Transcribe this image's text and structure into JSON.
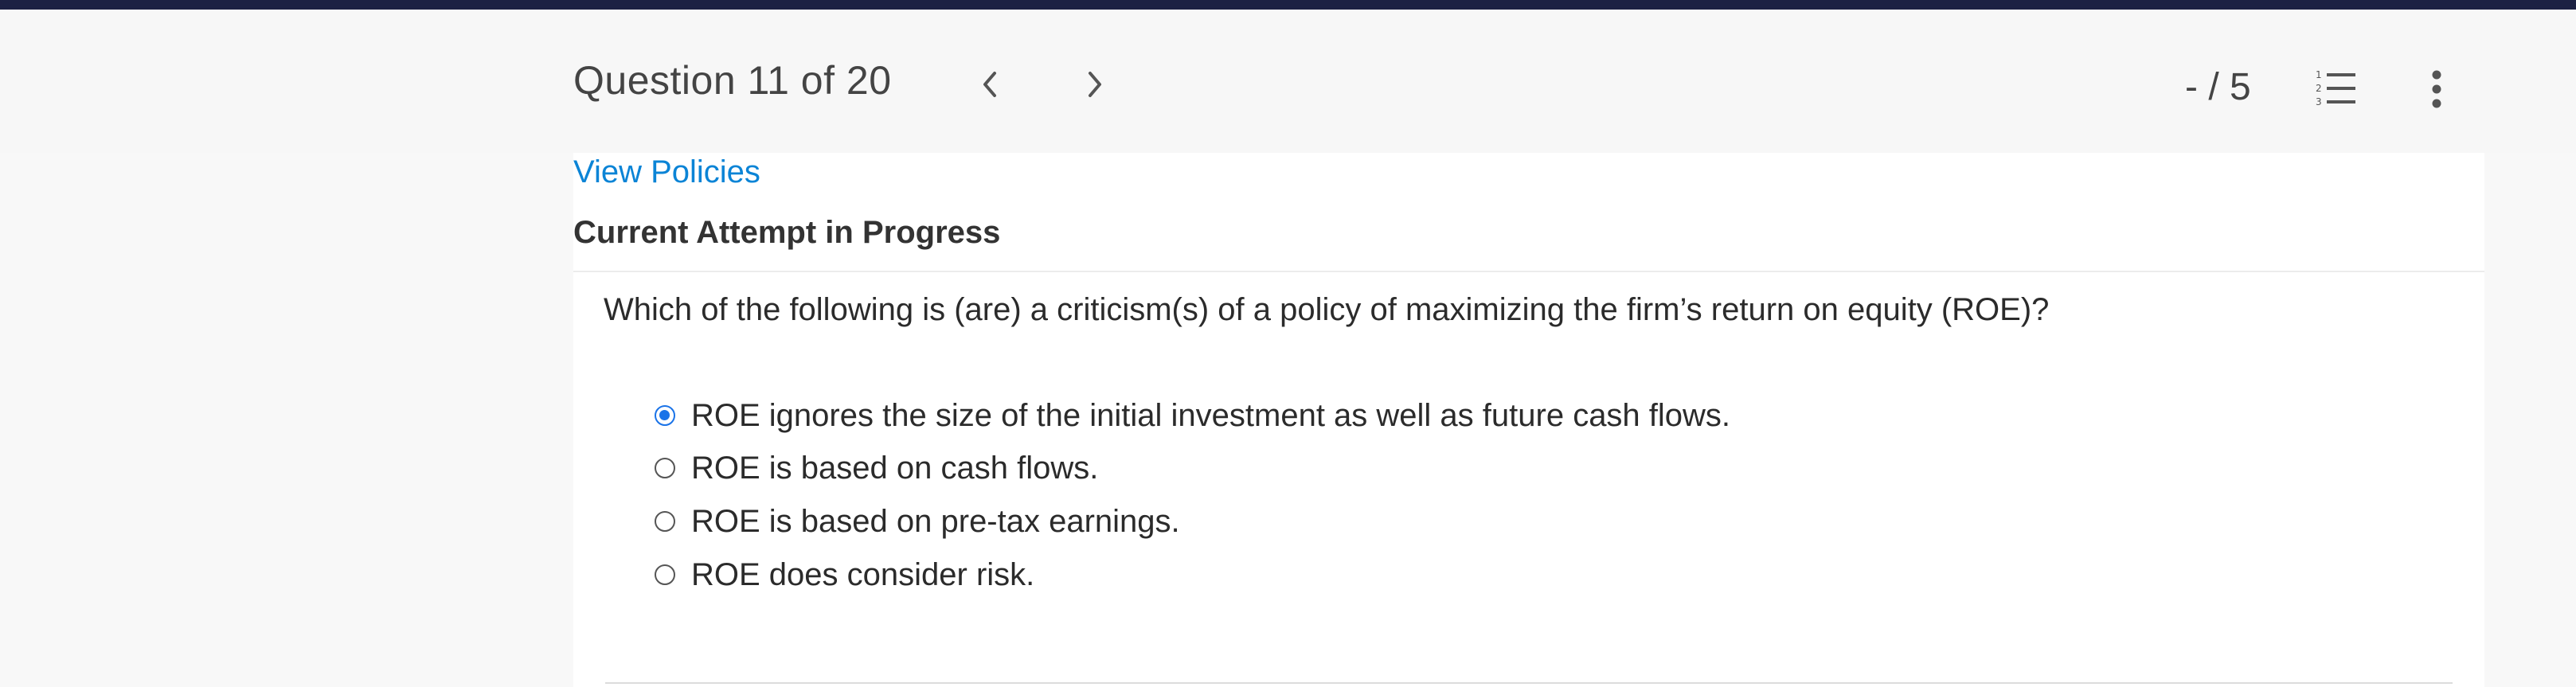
{
  "header": {
    "question_title": "Question 11 of 20",
    "score": "- / 5",
    "prev_icon": "chevron-left-icon",
    "next_icon": "chevron-right-icon",
    "list_icon": "numbered-list-icon",
    "more_icon": "more-vertical-icon"
  },
  "links": {
    "view_policies": "View Policies"
  },
  "attempt_status": "Current Attempt in Progress",
  "question": {
    "text": "Which of the following is (are) a criticism(s) of a policy of maximizing the firm’s return on equity (ROE)?",
    "options": [
      {
        "label": "ROE ignores the size of the initial investment as well as future cash flows.",
        "selected": true
      },
      {
        "label": "ROE is based on cash flows.",
        "selected": false
      },
      {
        "label": "ROE is based on pre-tax earnings.",
        "selected": false
      },
      {
        "label": "ROE does consider risk.",
        "selected": false
      }
    ]
  },
  "colors": {
    "top_bar": "#1c2143",
    "link": "#0b84d6",
    "radio_selected": "#1a73e8"
  }
}
